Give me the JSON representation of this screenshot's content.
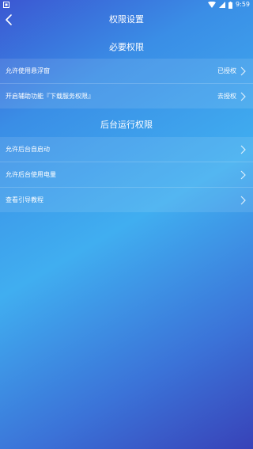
{
  "status_bar": {
    "time": "9:59",
    "icons": [
      "android-icon",
      "wifi-icon",
      "signal-icon",
      "battery-icon"
    ]
  },
  "header": {
    "title": "权限设置",
    "back_icon": "back-arrow-icon"
  },
  "sections": [
    {
      "title": "必要权限",
      "items": [
        {
          "label": "允许使用悬浮窗",
          "value": "已授权"
        },
        {
          "label": "开启辅助功能『下载服务权限』",
          "value": "去授权"
        }
      ]
    },
    {
      "title": "后台运行权限",
      "items": [
        {
          "label": "允许后台自启动",
          "value": ""
        },
        {
          "label": "允许后台使用电量",
          "value": ""
        },
        {
          "label": "查看引导教程",
          "value": ""
        }
      ]
    }
  ],
  "colors": {
    "gradient_top": "#3b57d2",
    "gradient_mid": "#40aef0",
    "gradient_bottom": "#3842b8",
    "text": "#ffffff"
  }
}
